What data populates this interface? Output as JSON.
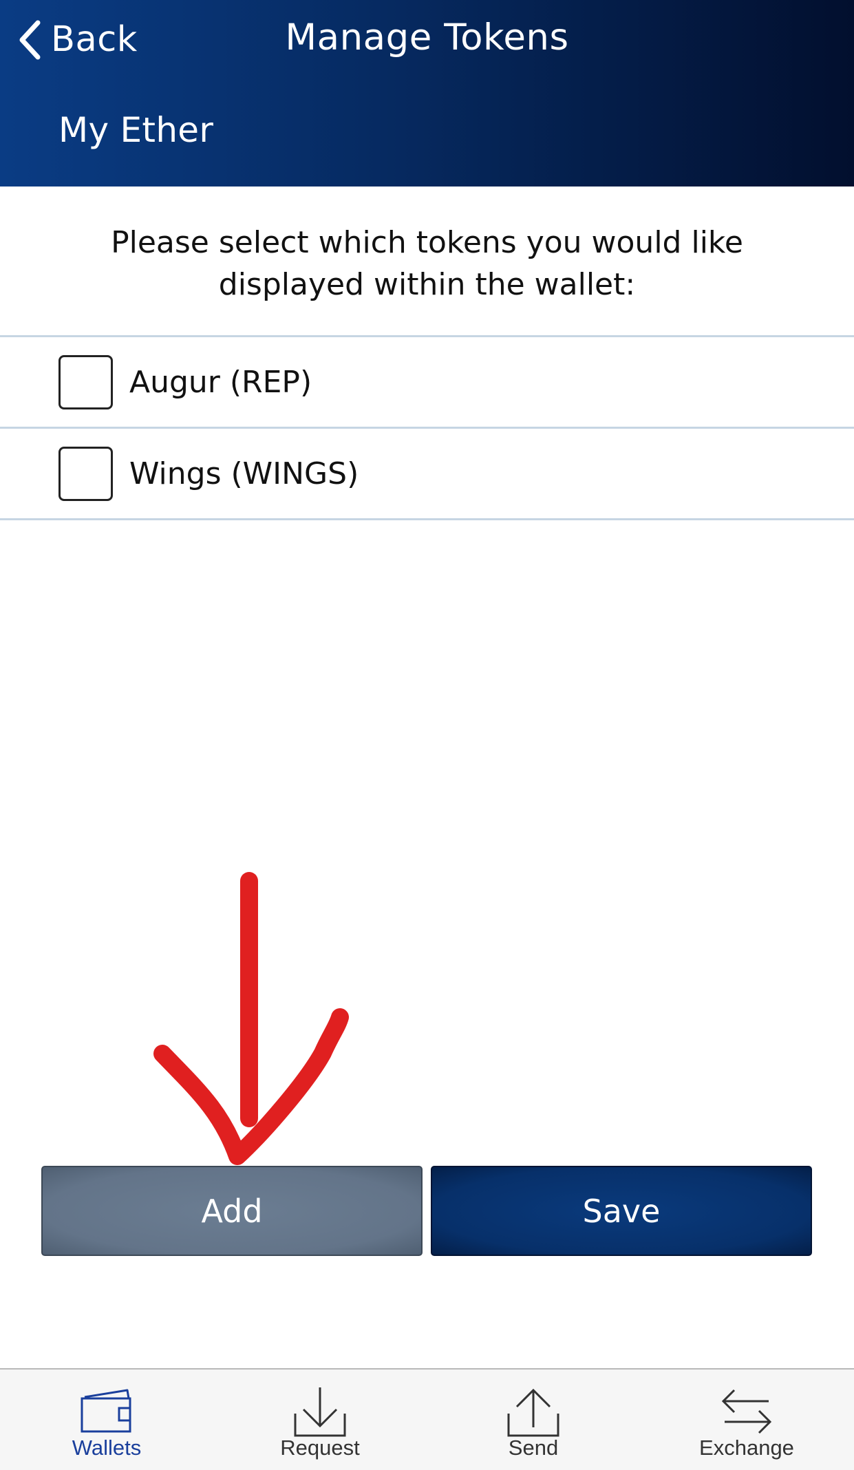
{
  "colors": {
    "header_start": "#0a3c84",
    "header_end": "#020f2e",
    "add_button": "#637489",
    "save_button": "#07306a",
    "active_tab": "#1a3f9c",
    "annotation_arrow": "#e02020"
  },
  "header": {
    "back_label": "Back",
    "title": "Manage Tokens",
    "subtitle": "My Ether"
  },
  "instruction": "Please select which tokens you would like displayed within the wallet:",
  "tokens": [
    {
      "label": "Augur (REP)",
      "checked": false
    },
    {
      "label": "Wings (WINGS)",
      "checked": false
    }
  ],
  "buttons": {
    "add_label": "Add",
    "save_label": "Save"
  },
  "tabs": [
    {
      "label": "Wallets",
      "icon": "wallet-icon",
      "active": true
    },
    {
      "label": "Request",
      "icon": "download-icon",
      "active": false
    },
    {
      "label": "Send",
      "icon": "upload-icon",
      "active": false
    },
    {
      "label": "Exchange",
      "icon": "exchange-arrows-icon",
      "active": false
    }
  ]
}
